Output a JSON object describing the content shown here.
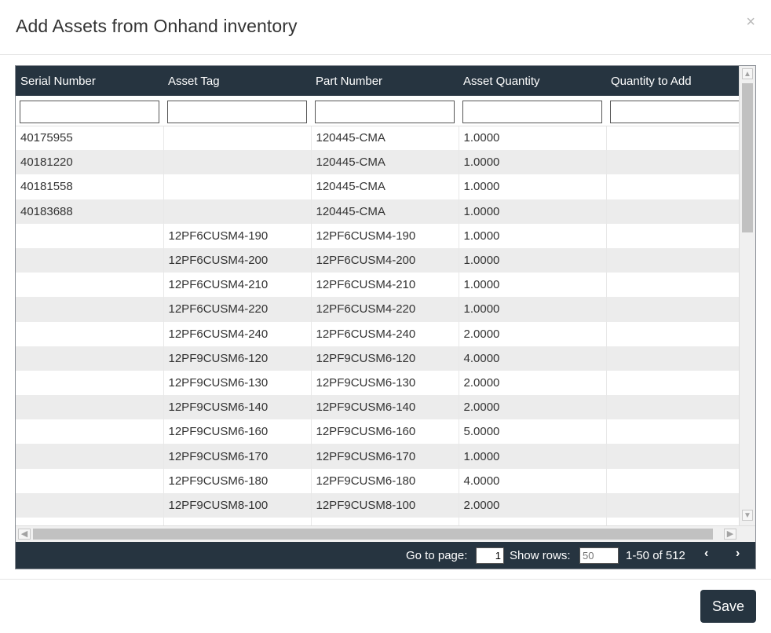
{
  "modal": {
    "title": "Add Assets from Onhand inventory",
    "close_symbol": "×"
  },
  "grid": {
    "columns": [
      "Serial Number",
      "Asset Tag",
      "Part Number",
      "Asset Quantity",
      "Quantity to Add"
    ],
    "rows": [
      [
        "40175955",
        "",
        "120445-CMA",
        "1.0000",
        ""
      ],
      [
        "40181220",
        "",
        "120445-CMA",
        "1.0000",
        ""
      ],
      [
        "40181558",
        "",
        "120445-CMA",
        "1.0000",
        ""
      ],
      [
        "40183688",
        "",
        "120445-CMA",
        "1.0000",
        ""
      ],
      [
        "",
        "12PF6CUSM4-190",
        "12PF6CUSM4-190",
        "1.0000",
        ""
      ],
      [
        "",
        "12PF6CUSM4-200",
        "12PF6CUSM4-200",
        "1.0000",
        ""
      ],
      [
        "",
        "12PF6CUSM4-210",
        "12PF6CUSM4-210",
        "1.0000",
        ""
      ],
      [
        "",
        "12PF6CUSM4-220",
        "12PF6CUSM4-220",
        "1.0000",
        ""
      ],
      [
        "",
        "12PF6CUSM4-240",
        "12PF6CUSM4-240",
        "2.0000",
        ""
      ],
      [
        "",
        "12PF9CUSM6-120",
        "12PF9CUSM6-120",
        "4.0000",
        ""
      ],
      [
        "",
        "12PF9CUSM6-130",
        "12PF9CUSM6-130",
        "2.0000",
        ""
      ],
      [
        "",
        "12PF9CUSM6-140",
        "12PF9CUSM6-140",
        "2.0000",
        ""
      ],
      [
        "",
        "12PF9CUSM6-160",
        "12PF9CUSM6-160",
        "5.0000",
        ""
      ],
      [
        "",
        "12PF9CUSM6-170",
        "12PF9CUSM6-170",
        "1.0000",
        ""
      ],
      [
        "",
        "12PF9CUSM6-180",
        "12PF9CUSM6-180",
        "4.0000",
        ""
      ],
      [
        "",
        "12PF9CUSM8-100",
        "12PF9CUSM8-100",
        "2.0000",
        ""
      ],
      [
        "",
        "",
        "",
        "",
        ""
      ]
    ]
  },
  "pager": {
    "go_to_page_label": "Go to page:",
    "current_page": "1",
    "show_rows_label": "Show rows:",
    "rows_placeholder": "50",
    "range_text": "1-50 of 512",
    "prev_symbol": "‹",
    "next_symbol": "›"
  },
  "footer": {
    "save_label": "Save"
  },
  "colors": {
    "header_bg": "#263440",
    "row_alt_bg": "#ececec",
    "button_bg": "#263440"
  }
}
